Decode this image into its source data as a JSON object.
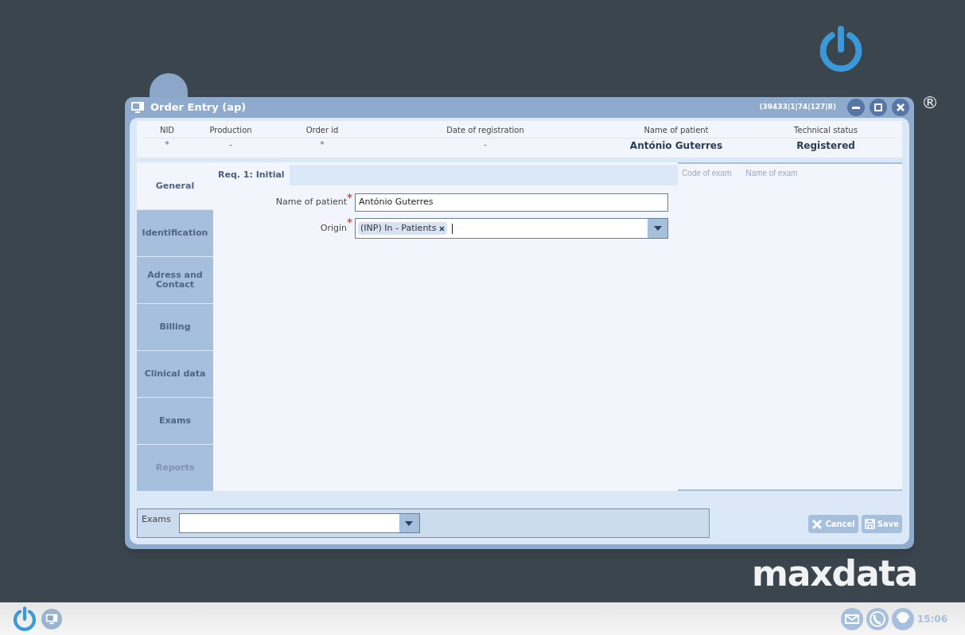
{
  "desktop": {
    "registered_mark": "®",
    "brand": "maxdata"
  },
  "window": {
    "title": "Order Entry (ap)",
    "session_code": "(39433|1|74|127|8)"
  },
  "summary": {
    "columns": [
      {
        "label": "NID",
        "value": "*",
        "bold": false
      },
      {
        "label": "Production",
        "value": "-",
        "bold": false
      },
      {
        "label": "Order id",
        "value": "*",
        "bold": false
      },
      {
        "label": "Date of registration",
        "value": "-",
        "bold": false
      },
      {
        "label": "Name of patient",
        "value": "António Guterres",
        "bold": true
      },
      {
        "label": "Technical status",
        "value": "Registered",
        "bold": true
      }
    ]
  },
  "tabs": [
    {
      "label": "General",
      "selected": true,
      "disabled": false
    },
    {
      "label": "Identification",
      "selected": false,
      "disabled": false
    },
    {
      "label": "Adress and Contact",
      "selected": false,
      "disabled": false
    },
    {
      "label": "Billing",
      "selected": false,
      "disabled": false
    },
    {
      "label": "Clinical data",
      "selected": false,
      "disabled": false
    },
    {
      "label": "Exams",
      "selected": false,
      "disabled": false
    },
    {
      "label": "Reports",
      "selected": false,
      "disabled": true
    }
  ],
  "request_tab": {
    "label": "Req. 1: Initial"
  },
  "form": {
    "fields": [
      {
        "kind": "text",
        "label": "Name of patient",
        "required": true,
        "value": "António Guterres"
      },
      {
        "kind": "select",
        "label": "Origin",
        "required": true,
        "tags": [
          "(INP) In - Patients"
        ]
      }
    ]
  },
  "exam_table": {
    "columns": [
      "Code of exam",
      "Name of exam"
    ]
  },
  "exams_picker": {
    "label": "Exams"
  },
  "buttons": [
    {
      "kind": "cancel",
      "label": "Cancel"
    },
    {
      "kind": "save",
      "label": "Save"
    }
  ],
  "taskbar": {
    "time": "15:06"
  }
}
